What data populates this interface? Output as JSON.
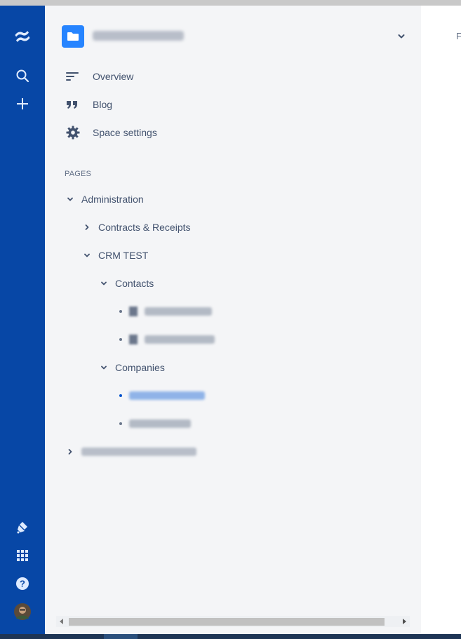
{
  "global_nav": {
    "items": [
      {
        "name": "confluence-logo-icon"
      },
      {
        "name": "search-icon"
      },
      {
        "name": "create-icon"
      },
      {
        "name": "notifications-icon"
      },
      {
        "name": "app-switcher-icon"
      },
      {
        "name": "help-icon"
      },
      {
        "name": "profile-avatar"
      }
    ]
  },
  "sidebar": {
    "space_icon": "folder-icon",
    "nav": [
      {
        "label": "Overview",
        "icon": "overview-icon"
      },
      {
        "label": "Blog",
        "icon": "blog-quote-icon"
      },
      {
        "label": "Space settings",
        "icon": "gear-icon"
      }
    ],
    "pages_label": "PAGES",
    "tree": {
      "administration": "Administration",
      "contracts": "Contracts & Receipts",
      "crm_test": "CRM TEST",
      "contacts": "Contacts",
      "companies": "Companies"
    }
  },
  "main": {
    "peek_text": "F"
  },
  "colors": {
    "global_nav": "#0747a6",
    "sidebar_bg": "#f4f5f7",
    "space_avatar": "#2684ff",
    "text": "#42526e",
    "link": "#0052cc"
  }
}
